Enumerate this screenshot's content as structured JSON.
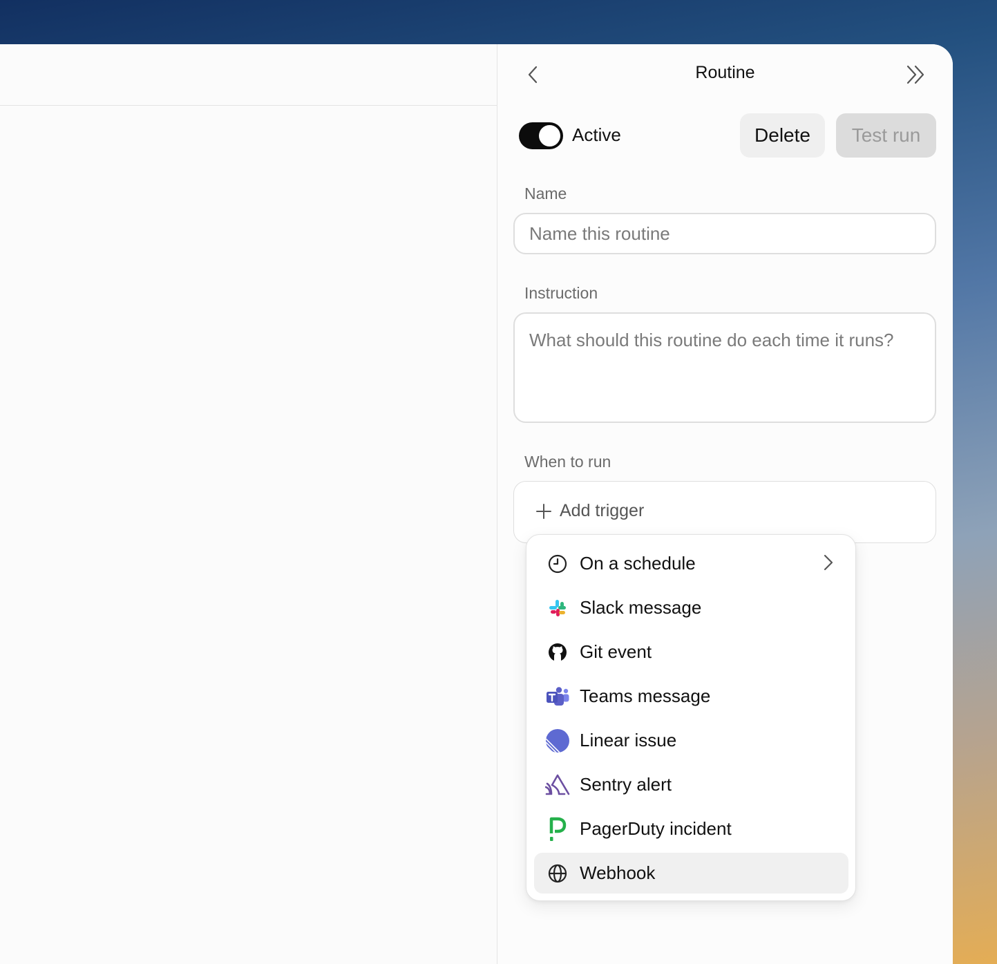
{
  "panel": {
    "title": "Routine",
    "active_label": "Active",
    "active": true,
    "delete_label": "Delete",
    "test_run_label": "Test run",
    "name_label": "Name",
    "name_placeholder": "Name this routine",
    "name_value": "",
    "instruction_label": "Instruction",
    "instruction_placeholder": "What should this routine do each time it runs?",
    "instruction_value": "",
    "when_label": "When to run",
    "add_trigger_label": "Add trigger"
  },
  "menu": {
    "items": [
      {
        "label": "On a schedule",
        "icon": "clock-icon",
        "has_submenu": true
      },
      {
        "label": "Slack message",
        "icon": "slack-icon"
      },
      {
        "label": "Git event",
        "icon": "github-icon"
      },
      {
        "label": "Teams message",
        "icon": "teams-icon"
      },
      {
        "label": "Linear issue",
        "icon": "linear-icon"
      },
      {
        "label": "Sentry alert",
        "icon": "sentry-icon"
      },
      {
        "label": "PagerDuty incident",
        "icon": "pagerduty-icon"
      },
      {
        "label": "Webhook",
        "icon": "globe-icon",
        "highlighted": true
      }
    ]
  },
  "colors": {
    "toggle_on": "#0c0c0c",
    "highlight": "#f0f0f0",
    "linear": "#5e6ad2",
    "sentry": "#6c4fa1",
    "pagerduty": "#25b04b",
    "teams": "#5b5fc7"
  }
}
